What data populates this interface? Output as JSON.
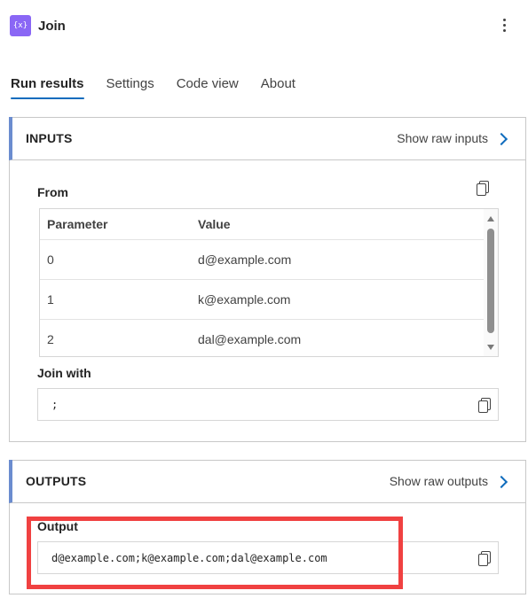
{
  "header": {
    "icon_glyph": "{x}",
    "icon_color": "#8a67f5",
    "title": "Join",
    "more_icon": "more-vertical-icon"
  },
  "tabs": [
    {
      "label": "Run results",
      "active": true
    },
    {
      "label": "Settings",
      "active": false
    },
    {
      "label": "Code view",
      "active": false
    },
    {
      "label": "About",
      "active": false
    }
  ],
  "inputs": {
    "heading": "INPUTS",
    "raw_link": "Show raw inputs",
    "from_label": "From",
    "table": {
      "columns": [
        "Parameter",
        "Value"
      ],
      "rows": [
        [
          "0",
          "d@example.com"
        ],
        [
          "1",
          "k@example.com"
        ],
        [
          "2",
          "dal@example.com"
        ]
      ]
    },
    "join_label": "Join with",
    "join_value": ";"
  },
  "outputs": {
    "heading": "OUTPUTS",
    "raw_link": "Show raw outputs",
    "output_label": "Output",
    "output_value": "d@example.com;k@example.com;dal@example.com"
  },
  "colors": {
    "accent": "#0f6cbd",
    "card_accent": "#6b8ccf",
    "highlight": "#f04141"
  }
}
